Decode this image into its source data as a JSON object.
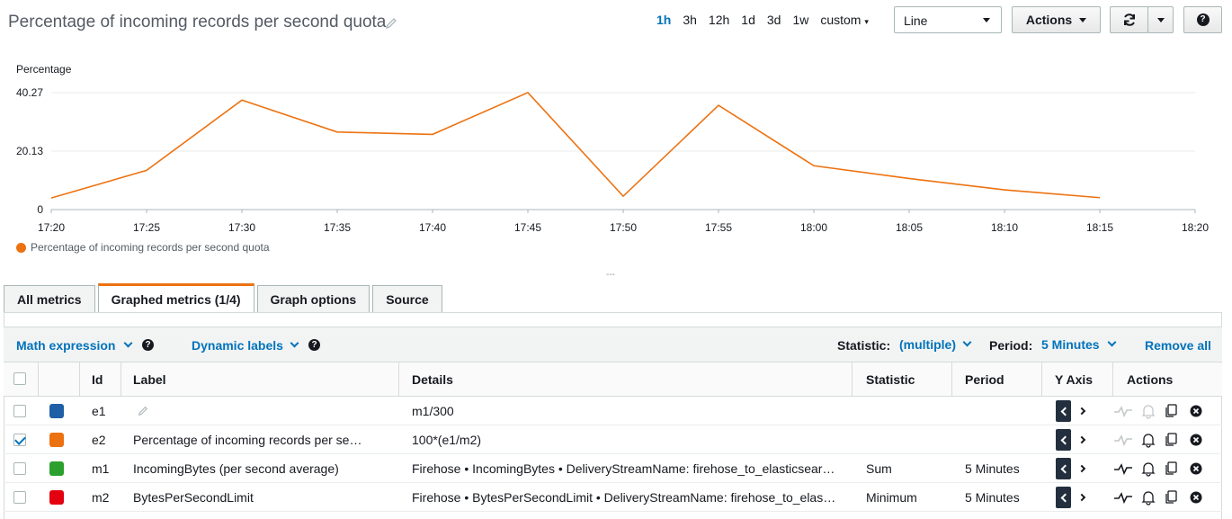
{
  "header": {
    "title": "Percentage of incoming records per second quota",
    "ranges": [
      "1h",
      "3h",
      "12h",
      "1d",
      "3d",
      "1w",
      "custom"
    ],
    "active_range": "1h",
    "chart_type_value": "Line",
    "actions_label": "Actions"
  },
  "chart": {
    "y_label": "Percentage",
    "y_ticks": [
      "40.27",
      "20.13",
      "0"
    ],
    "x_ticks": [
      "17:20",
      "17:25",
      "17:30",
      "17:35",
      "17:40",
      "17:45",
      "17:50",
      "17:55",
      "18:00",
      "18:05",
      "18:10",
      "18:15",
      "18:20"
    ],
    "legend": "Percentage of incoming records per second quota",
    "color": "#ec7211"
  },
  "chart_data": {
    "type": "line",
    "x": [
      "17:20",
      "17:25",
      "17:30",
      "17:35",
      "17:40",
      "17:45",
      "17:50",
      "17:55",
      "18:00",
      "18:05",
      "18:10",
      "18:15"
    ],
    "series": [
      {
        "name": "Percentage of incoming records per second quota",
        "values": [
          4,
          13.5,
          37.7,
          26.7,
          25.9,
          40.3,
          4.6,
          35.9,
          15.1,
          10.7,
          6.8,
          4.1
        ]
      }
    ],
    "ylabel": "Percentage",
    "ylim": [
      0,
      40.27
    ],
    "grid": true
  },
  "tabs": [
    "All metrics",
    "Graphed metrics (1/4)",
    "Graph options",
    "Source"
  ],
  "active_tab": 1,
  "toolbar": {
    "math_expression": "Math expression",
    "dynamic_labels": "Dynamic labels",
    "statistic_label": "Statistic:",
    "statistic_value": "(multiple)",
    "period_label": "Period:",
    "period_value": "5 Minutes",
    "remove_all": "Remove all"
  },
  "table": {
    "headers": [
      "Id",
      "Label",
      "Details",
      "Statistic",
      "Period",
      "Y Axis",
      "Actions"
    ],
    "rows": [
      {
        "checked": false,
        "color": "#1f5fa6",
        "id": "e1",
        "label": "",
        "details": "m1/300",
        "statistic": "",
        "period": ""
      },
      {
        "checked": true,
        "color": "#ec7211",
        "id": "e2",
        "label": "Percentage of incoming records per se…",
        "details": "100*(e1/m2)",
        "statistic": "",
        "period": ""
      },
      {
        "checked": false,
        "color": "#2ca02c",
        "id": "m1",
        "label": "IncomingBytes (per second average)",
        "details": "Firehose • IncomingBytes • DeliveryStreamName: firehose_to_elasticsear…",
        "statistic": "Sum",
        "period": "5 Minutes"
      },
      {
        "checked": false,
        "color": "#e3000f",
        "id": "m2",
        "label": "BytesPerSecondLimit",
        "details": "Firehose • BytesPerSecondLimit • DeliveryStreamName: firehose_to_elas…",
        "statistic": "Minimum",
        "period": "5 Minutes"
      }
    ]
  }
}
